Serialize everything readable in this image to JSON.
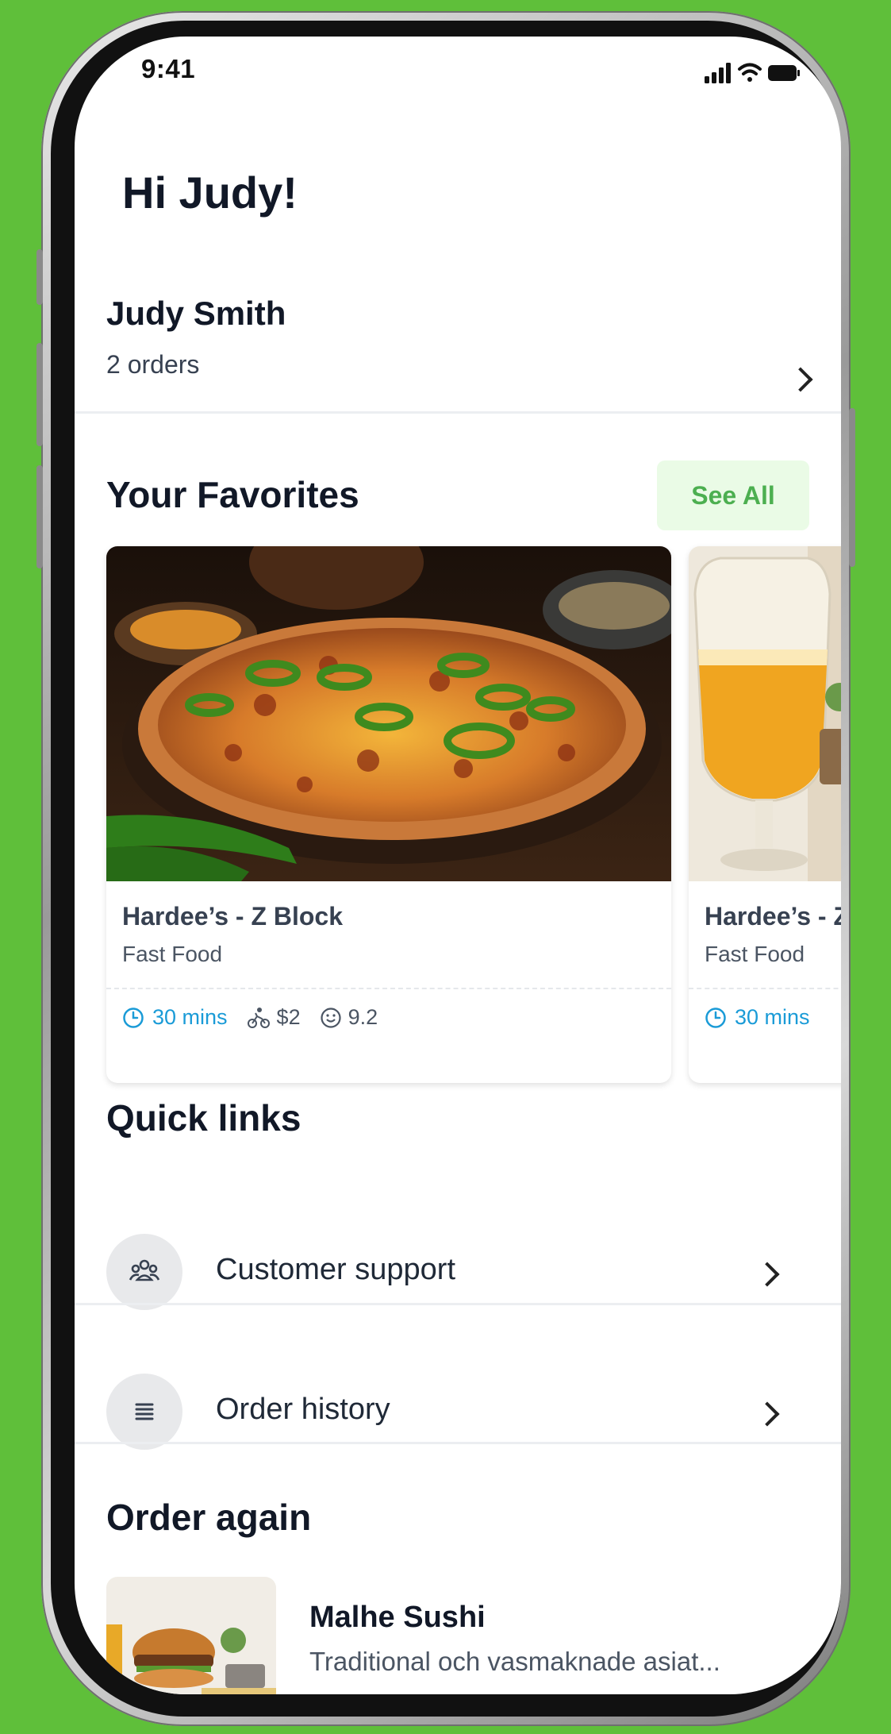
{
  "status_bar": {
    "time": "9:41"
  },
  "greeting": "Hi Judy!",
  "profile": {
    "name": "Judy Smith",
    "orders": "2 orders"
  },
  "favorites": {
    "title": "Your Favorites",
    "see_all_label": "See All",
    "cards": [
      {
        "name": "Hardee’s - Z Block",
        "category": "Fast Food",
        "time": "30 mins",
        "delivery_fee": "$2",
        "rating": "9.2",
        "image": "pizza-photo"
      },
      {
        "name": "Hardee’s - Z Block",
        "category": "Fast Food",
        "time": "30 mins",
        "image": "beer-photo"
      }
    ]
  },
  "quick_links": {
    "title": "Quick links",
    "items": [
      {
        "label": "Customer support",
        "icon": "people-icon"
      },
      {
        "label": "Order history",
        "icon": "list-icon"
      }
    ]
  },
  "order_again": {
    "title": "Order again",
    "items": [
      {
        "name": "Malhe Sushi",
        "description": "Traditional och vasmaknade asiat...",
        "image": "burger-photo"
      }
    ]
  },
  "colors": {
    "background": "#5fbf3a",
    "accent_green": "#4caf50",
    "see_all_bg": "#eafbe6",
    "time_blue": "#1a9bd7"
  }
}
